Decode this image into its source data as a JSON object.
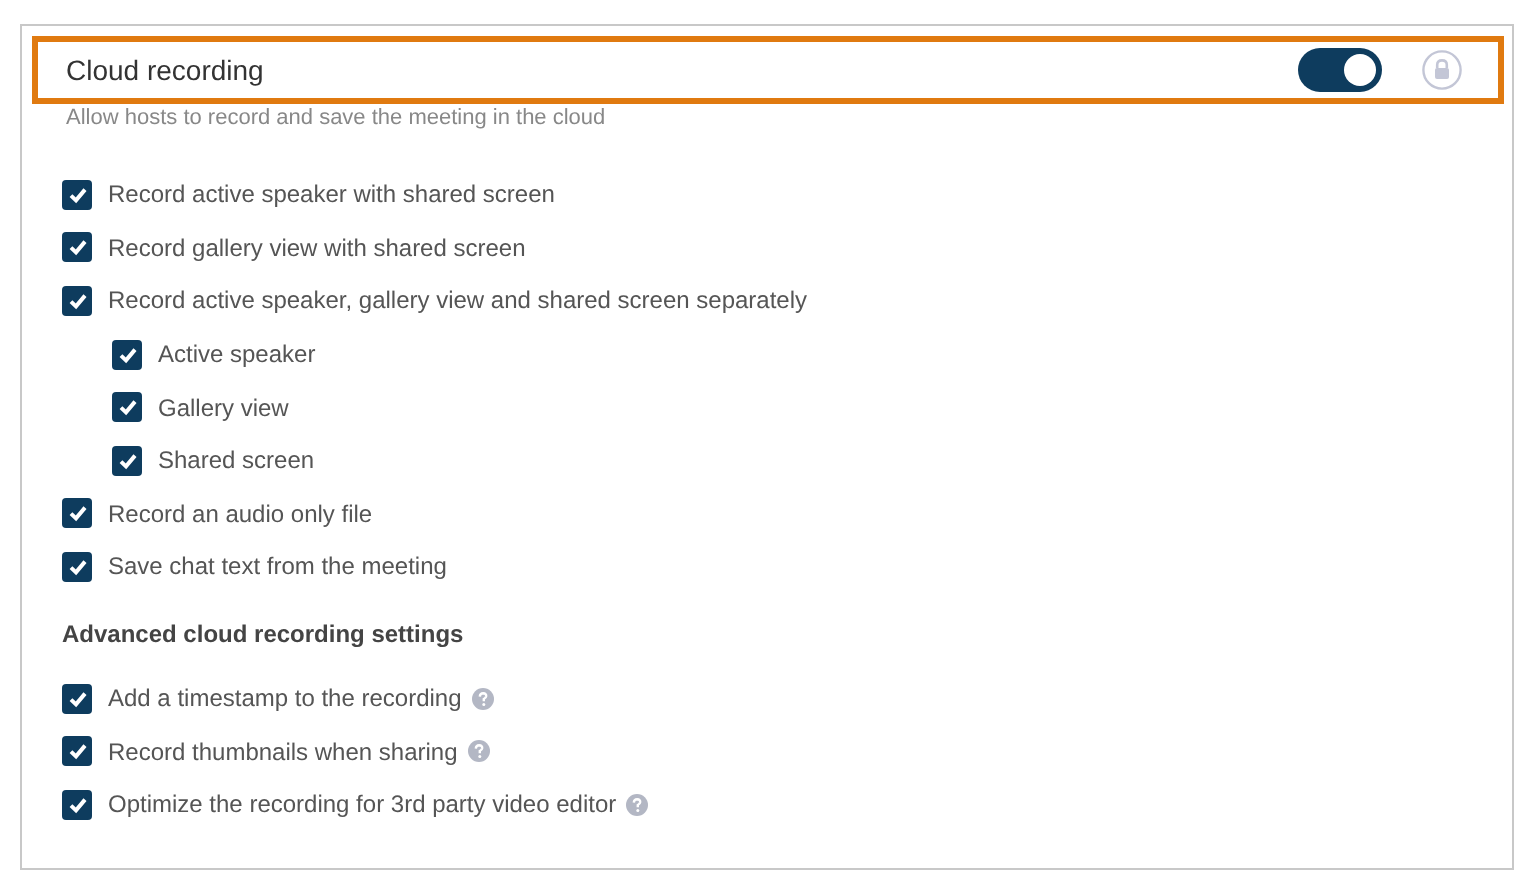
{
  "setting": {
    "title": "Cloud recording",
    "highlighted": true,
    "on": true,
    "locked": false,
    "description": "Allow hosts to record and save the meeting in the cloud"
  },
  "options": [
    {
      "label": "Record active speaker with shared screen",
      "checked": true,
      "help": false
    },
    {
      "label": "Record gallery view with shared screen",
      "checked": true,
      "help": false
    },
    {
      "label": "Record active speaker, gallery view and shared screen separately",
      "checked": true,
      "help": false,
      "children": [
        {
          "label": "Active speaker",
          "checked": true,
          "help": false
        },
        {
          "label": "Gallery view",
          "checked": true,
          "help": false
        },
        {
          "label": "Shared screen",
          "checked": true,
          "help": false
        }
      ]
    },
    {
      "label": "Record an audio only file",
      "checked": true,
      "help": false
    },
    {
      "label": "Save chat text from the meeting",
      "checked": true,
      "help": false
    }
  ],
  "advanced": {
    "heading": "Advanced cloud recording settings",
    "options": [
      {
        "label": "Add a timestamp to the recording",
        "checked": true,
        "help": true
      },
      {
        "label": "Record thumbnails when sharing",
        "checked": true,
        "help": true
      },
      {
        "label": "Optimize the recording for 3rd party video editor",
        "checked": true,
        "help": true
      }
    ]
  }
}
